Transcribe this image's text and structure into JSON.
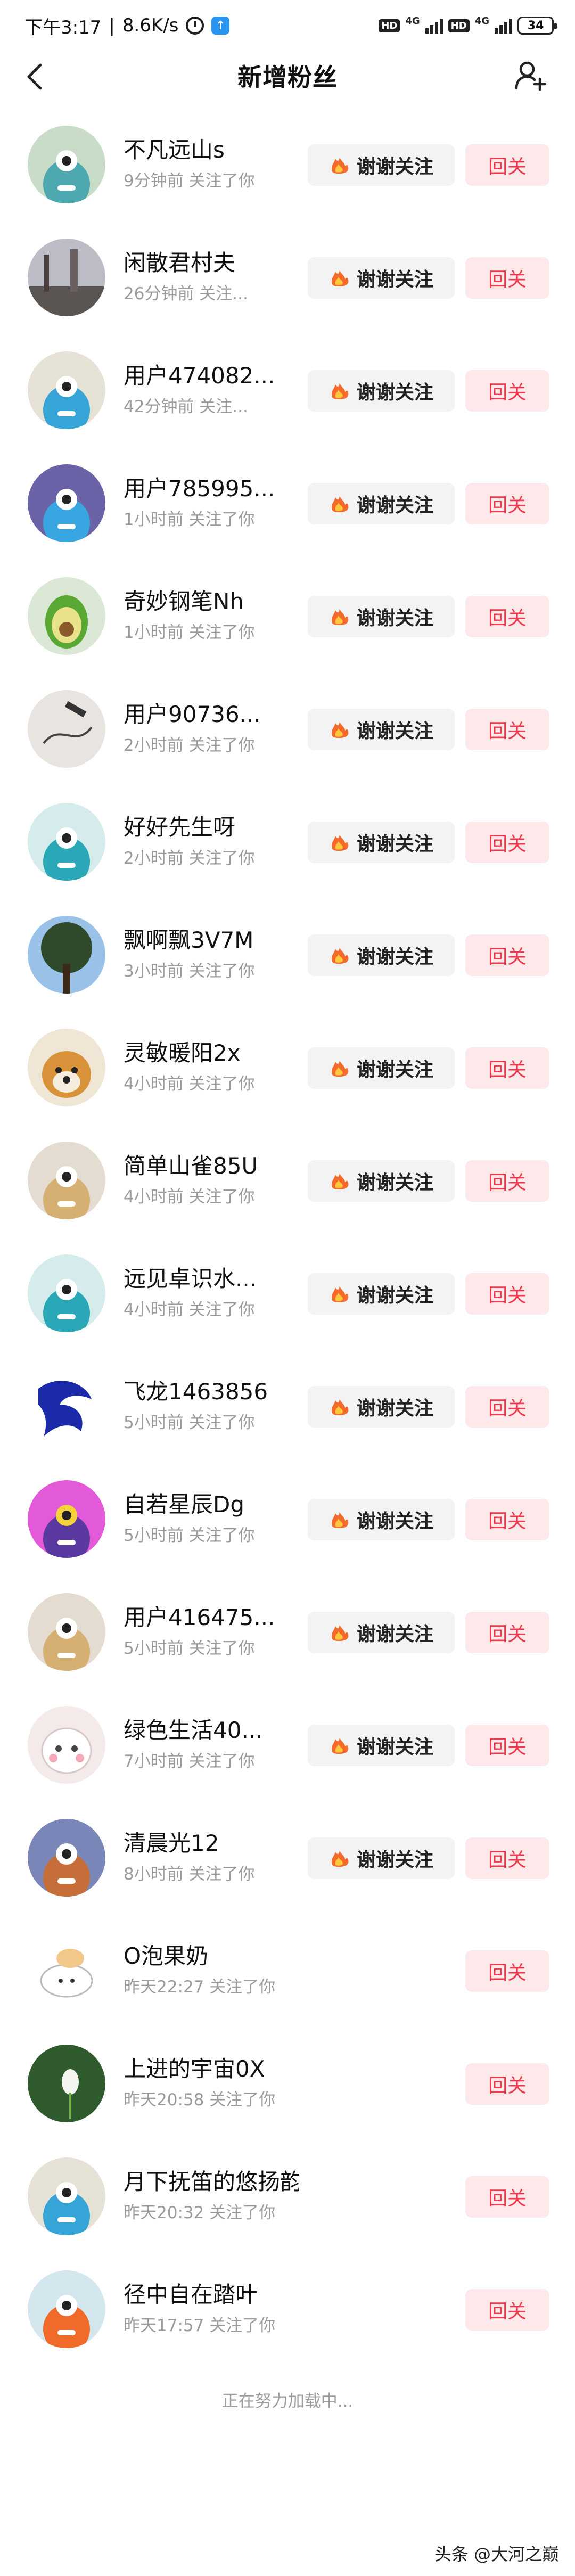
{
  "status_bar": {
    "time": "下午3:17",
    "separator": "|",
    "speed": "8.6K/s",
    "net_1": "4G",
    "net_2": "4G",
    "hd_1": "HD",
    "hd_2": "HD",
    "battery": "34"
  },
  "header": {
    "title": "新增粉丝"
  },
  "followers": [
    {
      "name": "不凡远山s",
      "meta": "9分钟前 关注了你",
      "avatar": "monster-teal",
      "show_thanks": true
    },
    {
      "name": "闲散君村夫",
      "meta": "26分钟前 关注...",
      "avatar": "photo-street",
      "show_thanks": true
    },
    {
      "name": "用户474082...",
      "meta": "42分钟前 关注...",
      "avatar": "monster-blue",
      "show_thanks": true
    },
    {
      "name": "用户785995...",
      "meta": "1小时前 关注了你",
      "avatar": "monster-purple",
      "show_thanks": true
    },
    {
      "name": "奇妙钢笔Nh",
      "meta": "1小时前 关注了你",
      "avatar": "avocado",
      "show_thanks": true
    },
    {
      "name": "用户90736...",
      "meta": "2小时前 关注了你",
      "avatar": "photo-sketch",
      "show_thanks": true
    },
    {
      "name": "好好先生呀",
      "meta": "2小时前 关注了你",
      "avatar": "monster-cyan",
      "show_thanks": true
    },
    {
      "name": "飘啊飘3V7M",
      "meta": "3小时前 关注了你",
      "avatar": "photo-tree",
      "show_thanks": true
    },
    {
      "name": "灵敏暖阳2x",
      "meta": "4小时前 关注了你",
      "avatar": "photo-dog",
      "show_thanks": true
    },
    {
      "name": "简单山雀85U",
      "meta": "4小时前 关注了你",
      "avatar": "monster-beige",
      "show_thanks": true
    },
    {
      "name": "远见卓识水...",
      "meta": "4小时前 关注了你",
      "avatar": "monster-cyan",
      "show_thanks": true
    },
    {
      "name": "飞龙1463856",
      "meta": "5小时前 关注了你",
      "avatar": "dragon",
      "show_thanks": true
    },
    {
      "name": "自若星辰Dg",
      "meta": "5小时前 关注了你",
      "avatar": "monster-violet",
      "show_thanks": true
    },
    {
      "name": "用户416475...",
      "meta": "5小时前 关注了你",
      "avatar": "monster-beige",
      "show_thanks": true
    },
    {
      "name": "绿色生活40...",
      "meta": "7小时前 关注了你",
      "avatar": "photo-cat",
      "show_thanks": true
    },
    {
      "name": "清晨光12",
      "meta": "8小时前 关注了你",
      "avatar": "monster-slate",
      "show_thanks": true
    },
    {
      "name": "O泡果奶",
      "meta": "昨天22:27 关注了你",
      "avatar": "photo-cartoon",
      "show_thanks": false
    },
    {
      "name": "上进的宇宙0X",
      "meta": "昨天20:58 关注了你",
      "avatar": "photo-flower",
      "show_thanks": false
    },
    {
      "name": "月下抚笛的悠扬韵",
      "meta": "昨天20:32 关注了你",
      "avatar": "monster-blue",
      "show_thanks": false
    },
    {
      "name": "径中自在踏叶",
      "meta": "昨天17:57 关注了你",
      "avatar": "monster-orange",
      "show_thanks": false
    }
  ],
  "thanks_label": "谢谢关注",
  "follow_back_label": "回关",
  "loading_text": "正在努力加载中...",
  "watermark": "头条 @大河之巅",
  "colors": {
    "follow_back_bg": "#fde8ea",
    "follow_back_text": "#f0384d",
    "thanks_bg": "#f3f3f3",
    "meta_text": "#9b9b9b"
  },
  "icons": {
    "back": "chevron-left-icon",
    "add_user": "add-user-icon",
    "thanks": "fire-emoji-icon"
  }
}
